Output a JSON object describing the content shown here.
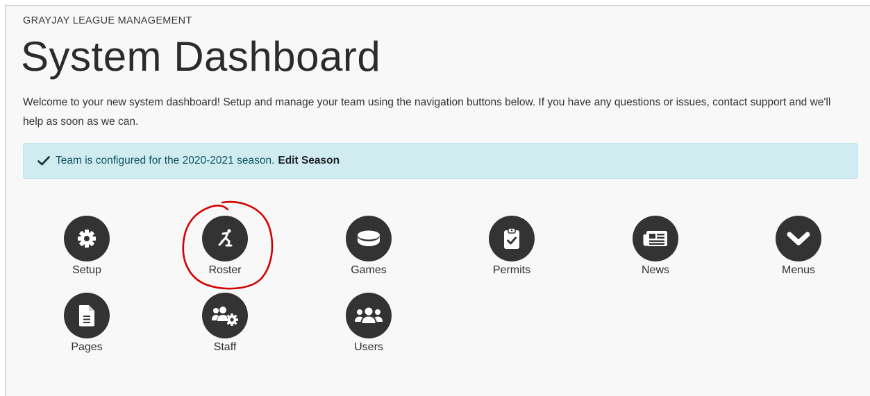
{
  "header": {
    "org_name": "GRAYJAY LEAGUE MANAGEMENT",
    "page_title": "System Dashboard",
    "welcome_text": "Welcome to your new system dashboard! Setup and manage your team using the navigation buttons below. If you have any questions or issues, contact support and we'll help as soon as we can."
  },
  "alert": {
    "message": "Team is configured for the 2020-2021 season.",
    "link_label": "Edit Season",
    "icon": "check-icon",
    "colors": {
      "background": "#d1ecf1",
      "text": "#0c5460"
    }
  },
  "tiles": [
    {
      "label": "Setup",
      "icon": "gear-icon"
    },
    {
      "label": "Roster",
      "icon": "skater-icon"
    },
    {
      "label": "Games",
      "icon": "puck-icon"
    },
    {
      "label": "Permits",
      "icon": "clipboard-check-icon"
    },
    {
      "label": "News",
      "icon": "newspaper-icon"
    },
    {
      "label": "Menus",
      "icon": "chevron-down-icon"
    },
    {
      "label": "Pages",
      "icon": "file-icon"
    },
    {
      "label": "Staff",
      "icon": "users-gear-icon"
    },
    {
      "label": "Users",
      "icon": "users-icon"
    }
  ],
  "colors": {
    "icon_circle": "#333333",
    "annotation": "#d40000"
  }
}
